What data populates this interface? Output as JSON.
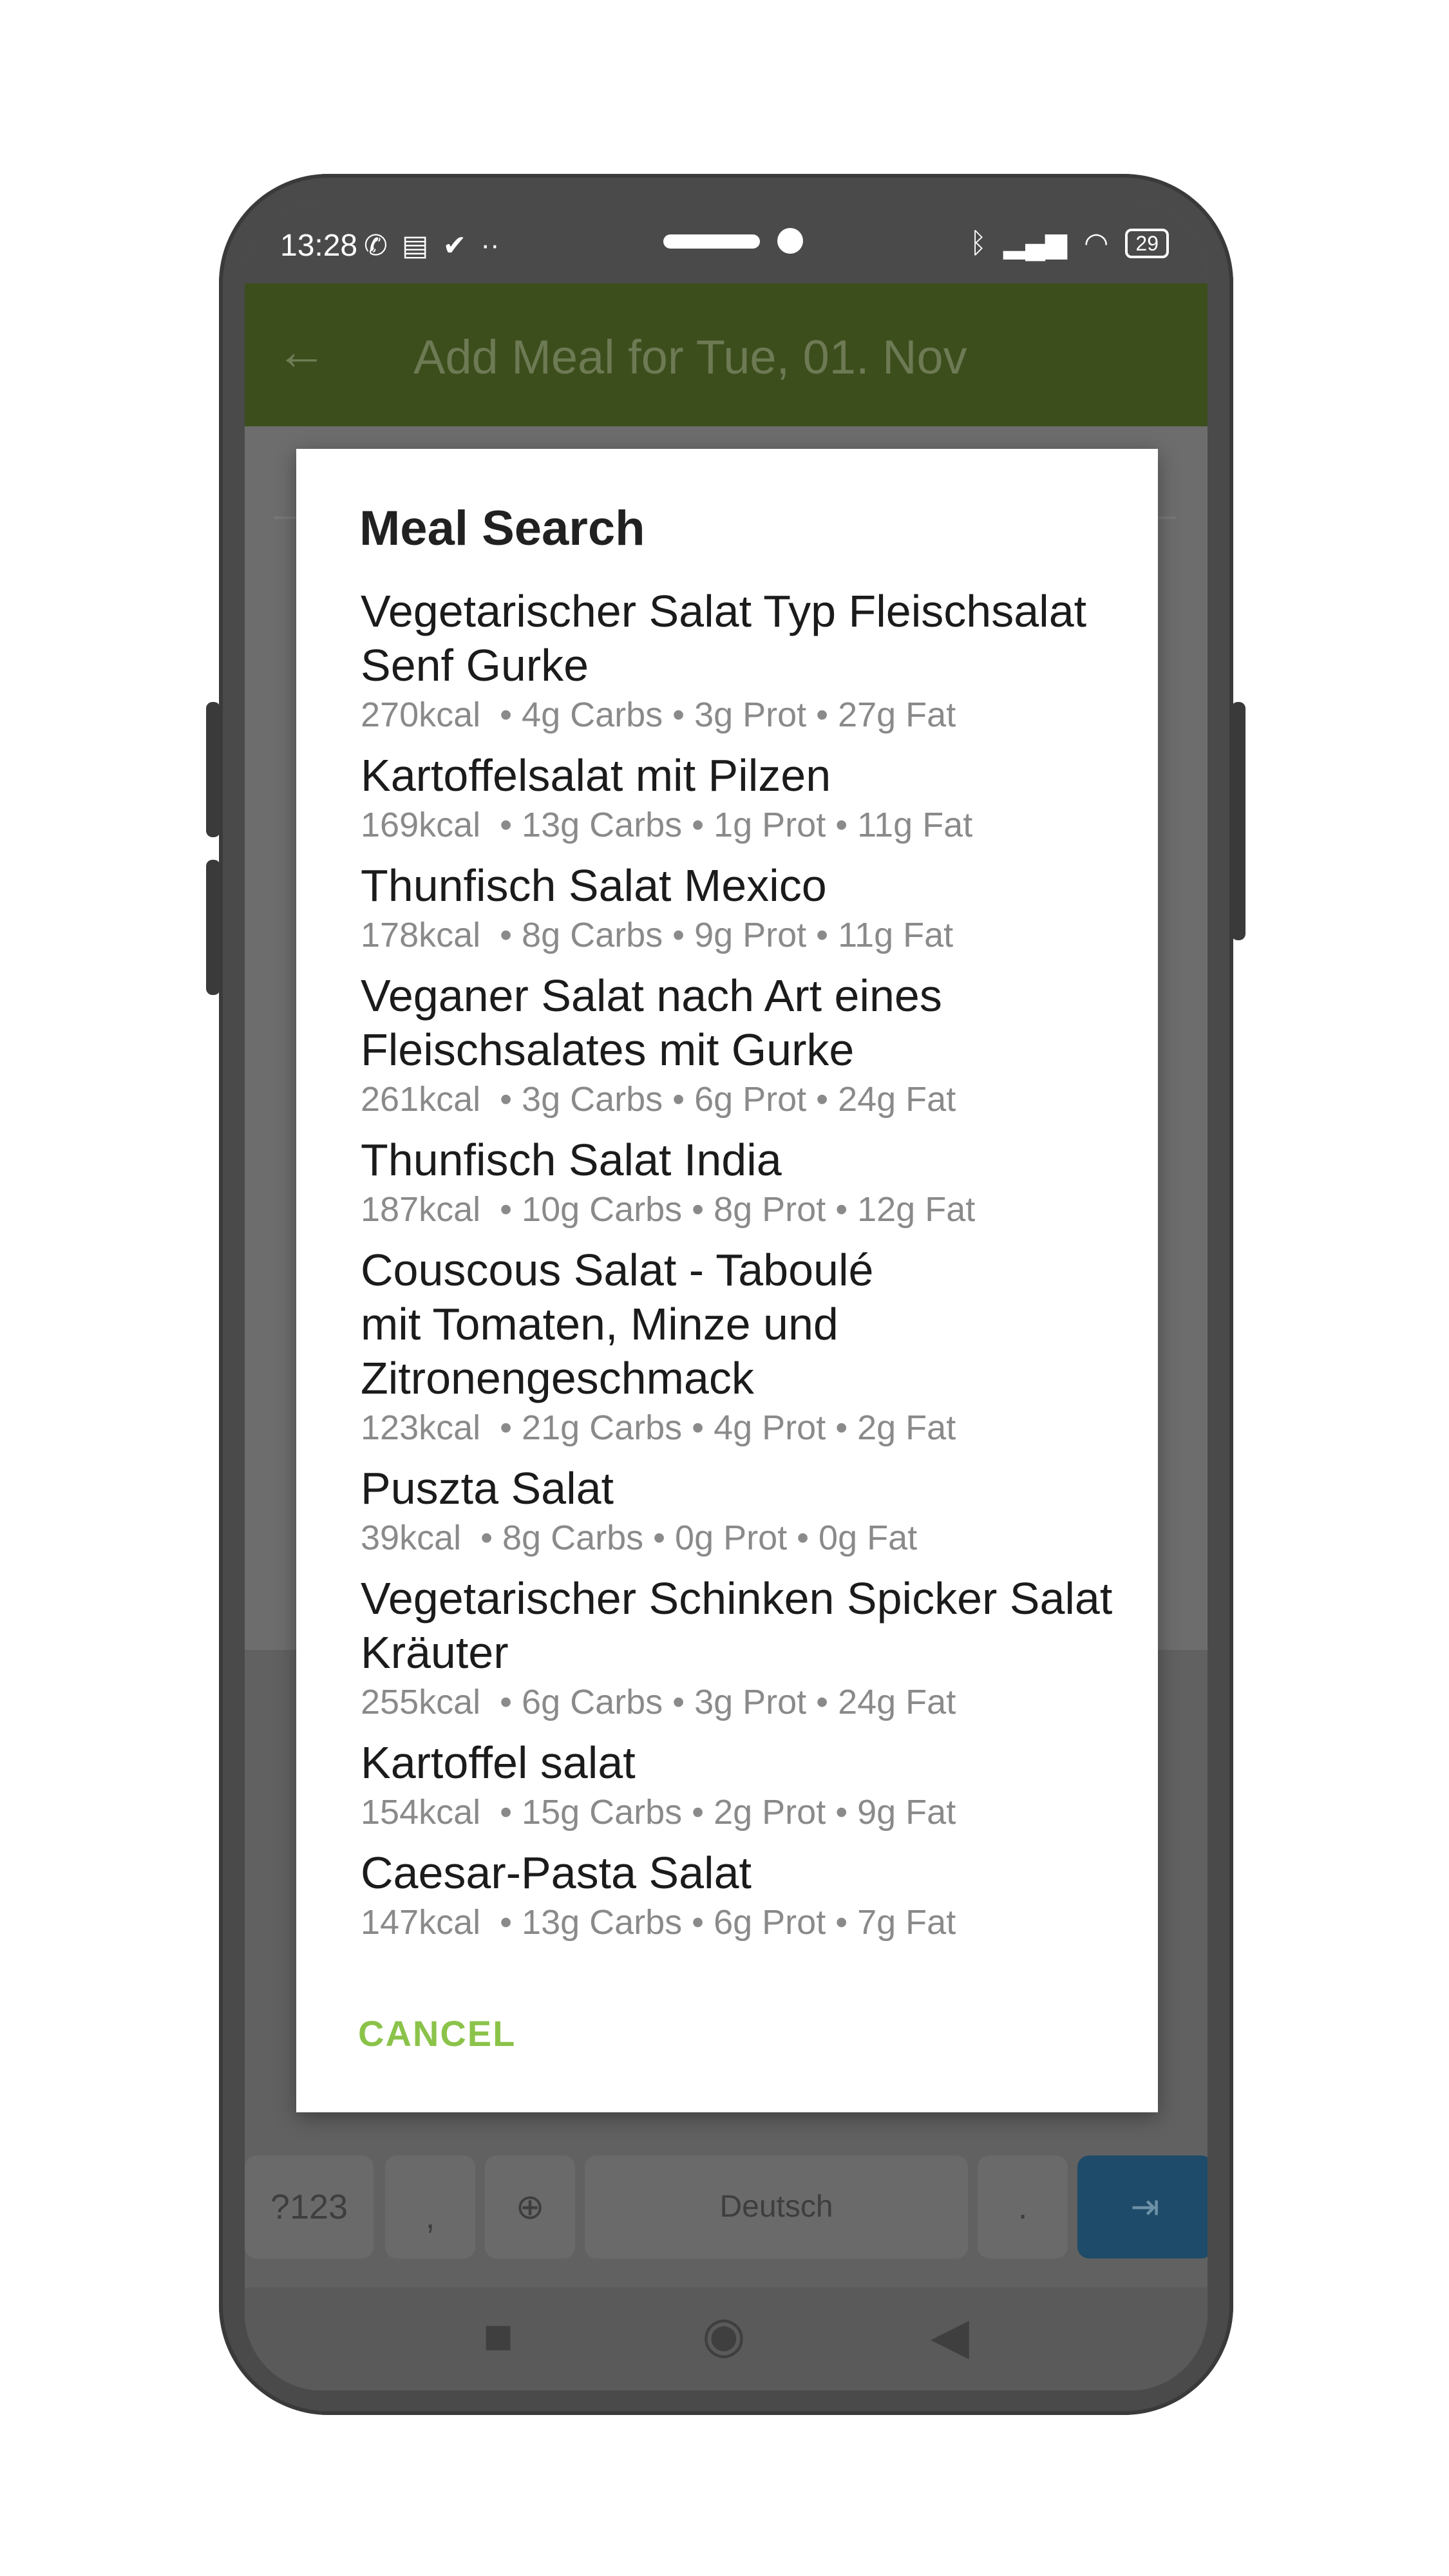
{
  "status": {
    "time": "13:28",
    "battery": "29",
    "left_icons": [
      "whatsapp-icon",
      "message-icon",
      "check-circle-icon",
      "more-dots-icon"
    ],
    "right_icons": [
      "bluetooth-icon",
      "signal-icon",
      "wifi-icon",
      "battery-icon"
    ]
  },
  "appbar": {
    "title": "Add Meal for Tue, 01. Nov"
  },
  "dialog": {
    "title": "Meal Search",
    "cancel_label": "CANCEL",
    "results": [
      {
        "name": "Vegetarischer Salat Typ Fleischsalat Senf Gurke",
        "macros": "270kcal  • 4g Carbs • 3g Prot • 27g Fat"
      },
      {
        "name": "Kartoffelsalat mit Pilzen",
        "macros": "169kcal  • 13g Carbs • 1g Prot • 11g Fat"
      },
      {
        "name": "Thunfisch Salat Mexico",
        "macros": "178kcal  • 8g Carbs • 9g Prot • 11g Fat"
      },
      {
        "name": "Veganer Salat nach Art eines Fleischsalates mit Gurke",
        "macros": "261kcal  • 3g Carbs • 6g Prot • 24g Fat"
      },
      {
        "name": "Thunfisch Salat India",
        "macros": "187kcal  • 10g Carbs • 8g Prot • 12g Fat"
      },
      {
        "name": "Couscous Salat - Taboulé\nmit Tomaten, Minze und Zitronengeschmack",
        "macros": "123kcal  • 21g Carbs • 4g Prot • 2g Fat"
      },
      {
        "name": "Puszta Salat",
        "macros": "39kcal  • 8g Carbs • 0g Prot • 0g Fat"
      },
      {
        "name": "Vegetarischer Schinken Spicker Salat Kräuter",
        "macros": "255kcal  • 6g Carbs • 3g Prot • 24g Fat"
      },
      {
        "name": "Kartoffel salat",
        "macros": "154kcal  • 15g Carbs • 2g Prot • 9g Fat"
      },
      {
        "name": "Caesar-Pasta Salat",
        "macros": "147kcal  • 13g Carbs • 6g Prot • 7g Fat"
      }
    ]
  },
  "keyboard": {
    "symbols_key": "?123",
    "emoji_comma_key": ",",
    "space_label": "Deutsch",
    "period_key": ".",
    "enter_icon": "tab-arrow-icon",
    "globe_icon": "globe-icon"
  },
  "navbar": {
    "icons": [
      "recent-apps-icon",
      "home-icon",
      "back-icon"
    ]
  },
  "colors": {
    "appbar": "#3d4e1d",
    "cancel": "#8bc34a",
    "enter_key": "#1e4b69"
  }
}
